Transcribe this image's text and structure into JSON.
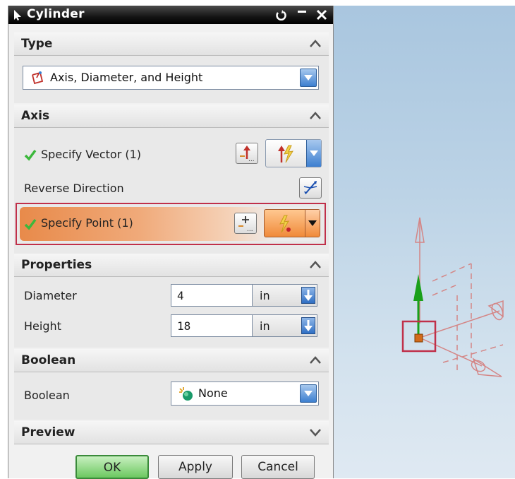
{
  "dialog": {
    "title": "Cylinder",
    "sections": {
      "type": {
        "title": "Type",
        "selected": "Axis, Diameter, and Height"
      },
      "axis": {
        "title": "Axis",
        "specify_vector": "Specify Vector (1)",
        "reverse_direction": "Reverse Direction",
        "specify_point": "Specify Point (1)"
      },
      "properties": {
        "title": "Properties",
        "diameter_label": "Diameter",
        "diameter_value": "4",
        "diameter_unit": "in",
        "height_label": "Height",
        "height_value": "18",
        "height_unit": "in"
      },
      "boolean": {
        "title": "Boolean",
        "label": "Boolean",
        "selected": "None"
      },
      "preview": {
        "title": "Preview"
      }
    },
    "buttons": {
      "ok": "OK",
      "apply": "Apply",
      "cancel": "Cancel"
    }
  },
  "colors": {
    "check_green": "#3cb83c",
    "highlight_orange": "#f0a070",
    "selection_red": "#c0304a",
    "axis_green": "#1aa01a",
    "preview_pink": "#d98a8a",
    "viewport_sky": "#bcd3e6"
  }
}
